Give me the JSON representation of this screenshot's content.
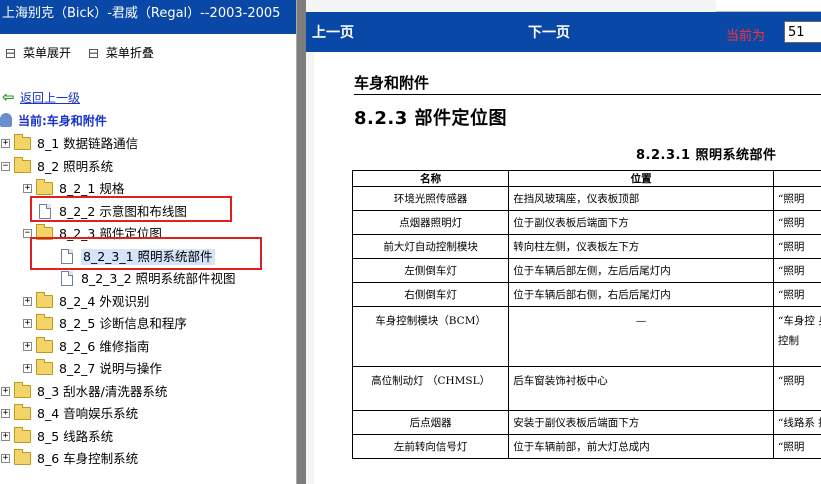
{
  "left_panel": {
    "title": "上海别克（Bick）-君威（Regal）--2003-2005",
    "menu": [
      {
        "label": "菜单展开",
        "icon": "expand-menu-icon"
      },
      {
        "label": "菜单折叠",
        "icon": "collapse-menu-icon"
      }
    ],
    "back_link": "返回上一级",
    "current_label": "当前:车身和附件",
    "tree": [
      {
        "label": "8_1 数据链路通信",
        "level": 0,
        "type": "folder",
        "expander": "+"
      },
      {
        "label": "8_2 照明系统",
        "level": 0,
        "type": "folder",
        "expander": "-"
      },
      {
        "label": "8_2_1 规格",
        "level": 1,
        "type": "folder",
        "expander": "+"
      },
      {
        "label": "8_2_2 示意图和布线图",
        "level": 1,
        "type": "doc",
        "expander": ""
      },
      {
        "label": "8_2_3 部件定位图",
        "level": 1,
        "type": "folder",
        "expander": "-"
      },
      {
        "label": "8_2_3_1 照明系统部件",
        "level": 2,
        "type": "doc",
        "expander": "",
        "selected": true
      },
      {
        "label": "8_2_3_2 照明系统部件视图",
        "level": 2,
        "type": "doc",
        "expander": ""
      },
      {
        "label": "8_2_4 外观识别",
        "level": 1,
        "type": "folder",
        "expander": "+"
      },
      {
        "label": "8_2_5 诊断信息和程序",
        "level": 1,
        "type": "folder",
        "expander": "+"
      },
      {
        "label": "8_2_6 维修指南",
        "level": 1,
        "type": "folder",
        "expander": "+"
      },
      {
        "label": "8_2_7 说明与操作",
        "level": 1,
        "type": "folder",
        "expander": "+"
      },
      {
        "label": "8_3 刮水器/清洗器系统",
        "level": 0,
        "type": "folder",
        "expander": "+"
      },
      {
        "label": "8_4 音响娱乐系统",
        "level": 0,
        "type": "folder",
        "expander": "+"
      },
      {
        "label": "8_5 线路系统",
        "level": 0,
        "type": "folder",
        "expander": "+"
      },
      {
        "label": "8_6 车身控制系统",
        "level": 0,
        "type": "folder",
        "expander": "+"
      }
    ]
  },
  "navigation": {
    "prev_label": "上一页",
    "next_label": "下一页",
    "current_page_label": "当前为",
    "current_page_value": "51"
  },
  "document": {
    "section_heading": "车身和附件",
    "sub_heading": "8.2.3 部件定位图",
    "table_title": "8.2.3.1 照明系统部件",
    "table": {
      "headers": [
        "名称",
        "位置",
        ""
      ],
      "rows": [
        [
          "环境光照传感器",
          "在挡风玻璃座，仪表板顶部",
          "“照明"
        ],
        [
          "点烟器照明灯",
          "位于副仪表板后端面下方",
          "“照明"
        ],
        [
          "前大灯自动控制模块",
          "转向柱左侧，仪表板左下方",
          "“照明"
        ],
        [
          "左侧倒车灯",
          "位于车辆后部左侧，左后后尾灯内",
          "“照明"
        ],
        [
          "右侧倒车灯",
          "位于车辆后部右侧，右后后尾灯内",
          "“照明"
        ],
        [
          "车身控制模块（BCM）",
          "—",
          "“车身控 身控制"
        ],
        [
          "高位制动灯 （CHMSL）",
          "后车窗装饰衬板中心",
          "“照明"
        ],
        [
          "后点烟器",
          "安装于副仪表板后端面下方",
          "“线路系 接"
        ],
        [
          "左前转向信号灯",
          "位于车辆前部，前大灯总成内",
          "“照明"
        ]
      ]
    }
  },
  "colors": {
    "title_bar_blue": "#0a48a8",
    "highlight_red": "#e02020",
    "link_blue": "#1a33c9",
    "page_label_red": "#ff3030"
  }
}
